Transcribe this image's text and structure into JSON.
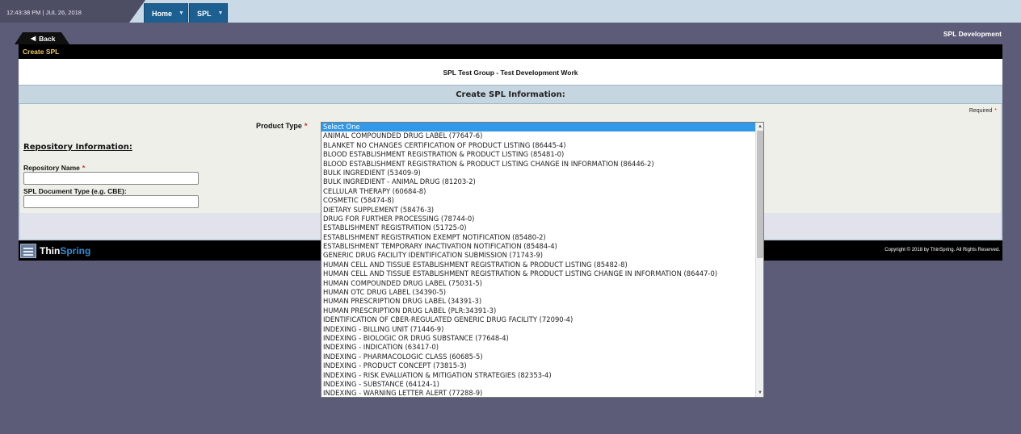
{
  "header": {
    "clock": "12:43:38 PM | JUL 26, 2018",
    "nav": [
      {
        "label": "Home"
      },
      {
        "label": "SPL"
      }
    ],
    "back_label": "Back",
    "page_context": "SPL Development"
  },
  "panel": {
    "title": "Create SPL",
    "group_title": "SPL Test Group  - Test Development Work",
    "section_title": "Create SPL Information:",
    "required_note": "Required",
    "product_type_label": "Product Type",
    "repo_heading": "Repository Information:",
    "repo_name_label": "Repository Name",
    "doc_type_label": "SPL Document Type (e.g. CBE):",
    "repo_name_value": "",
    "doc_type_value": ""
  },
  "footer": {
    "logo_thin": "Thin",
    "logo_spring": "Spring",
    "copyright": "Copyright © 2018 by ThinSpring. All Rights Reserved."
  },
  "product_type_options": [
    "Select One",
    "ANIMAL COMPOUNDED DRUG LABEL (77647-6)",
    "BLANKET NO CHANGES CERTIFICATION OF PRODUCT LISTING (86445-4)",
    "BLOOD ESTABLISHMENT REGISTRATION & PRODUCT LISTING (85481-0)",
    "BLOOD ESTABLISHMENT REGISTRATION & PRODUCT LISTING CHANGE IN INFORMATION (86446-2)",
    "BULK INGREDIENT (53409-9)",
    "BULK INGREDIENT - ANIMAL DRUG (81203-2)",
    "CELLULAR THERAPY (60684-8)",
    "COSMETIC (58474-8)",
    "DIETARY SUPPLEMENT (58476-3)",
    "DRUG FOR FURTHER PROCESSING (78744-0)",
    "ESTABLISHMENT REGISTRATION (51725-0)",
    "ESTABLISHMENT REGISTRATION EXEMPT NOTIFICATION (85480-2)",
    "ESTABLISHMENT TEMPORARY INACTIVATION NOTIFICATION (85484-4)",
    "GENERIC DRUG FACILITY IDENTIFICATION SUBMISSION (71743-9)",
    "HUMAN CELL AND TISSUE ESTABLISHMENT REGISTRATION & PRODUCT LISTING (85482-8)",
    "HUMAN CELL AND TISSUE ESTABLISHMENT REGISTRATION & PRODUCT LISTING CHANGE IN INFORMATION (86447-0)",
    "HUMAN COMPOUNDED DRUG LABEL (75031-5)",
    "HUMAN OTC DRUG LABEL (34390-5)",
    "HUMAN PRESCRIPTION DRUG LABEL (34391-3)",
    "HUMAN PRESCRIPTION DRUG LABEL (PLR:34391-3)",
    "IDENTIFICATION OF CBER-REGULATED GENERIC DRUG FACILITY (72090-4)",
    "INDEXING - BILLING UNIT (71446-9)",
    "INDEXING - BIOLOGIC OR DRUG SUBSTANCE (77648-4)",
    "INDEXING - INDICATION (63417-0)",
    "INDEXING - PHARMACOLOGIC CLASS (60685-5)",
    "INDEXING - PRODUCT CONCEPT (73815-3)",
    "INDEXING - RISK EVALUATION & MITIGATION STRATEGIES (82353-4)",
    "INDEXING - SUBSTANCE (64124-1)",
    "INDEXING - WARNING LETTER ALERT (77288-9)"
  ],
  "selected_option_index": 0,
  "colors": {
    "accent": "#1d5f91",
    "selected": "#3298e8",
    "required": "#d31f1f",
    "panel_title": "#f0c75e"
  }
}
